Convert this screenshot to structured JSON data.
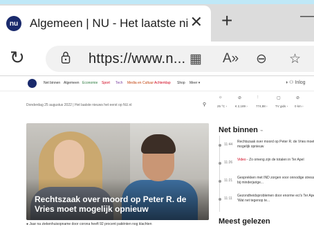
{
  "browser": {
    "tab_title": "Algemeen | NU - Het laatste nieu",
    "favicon_text": "nu",
    "close_symbol": "✕",
    "newtab_symbol": "+",
    "min_symbol": "—",
    "reload_symbol": "↻",
    "url": "https://www.n...",
    "icons": [
      "apps-icon",
      "read-aloud-icon",
      "zoom-out-icon",
      "favorites-add-icon"
    ],
    "icon_glyphs": [
      "▦",
      "A»",
      "⊖",
      "☆"
    ]
  },
  "site": {
    "nav_items": [
      "Net binnen",
      "Algemeen",
      "Economie",
      "Sport",
      "Tech",
      "Media en Cultuur",
      "Achterklap",
      "Shop",
      "Meer ▾"
    ],
    "nav_colors": [
      "#333333",
      "#333333",
      "#2b7a3d",
      "#d0021b",
      "#7a3ea0",
      "#c2410c",
      "#d0021b",
      "#333333",
      "#333333"
    ],
    "nav_right": "◑  ⚇  Inlog",
    "dateline": "Donderdag 25 augustus 2022   |   Het laatste nieuws het eerst op NU.nl",
    "search_symbol": "⚲"
  },
  "hero": {
    "headline": "Rechtszaak over moord op Peter R. de Vries moet mogelijk opnieuw"
  },
  "bullet_text": "●  Jaar na ziekenhuisopname door corona heeft 92 procent patiënten nog klachten",
  "weather": {
    "icons": [
      "☼",
      "⊘",
      "⫶",
      "▢",
      "⊘"
    ],
    "values": [
      "25 °C ›",
      "€ 2,189 ›",
      "774,88 ›",
      "TV gids ›",
      "0 km ›"
    ]
  },
  "net_binnen": {
    "title": "Net binnen",
    "rss": "⌁",
    "items": [
      {
        "time": "11:44",
        "prefix": "",
        "text": "Rechtszaak over moord op Peter R. de Vries moet mogelijk opnieuw"
      },
      {
        "time": "11:26",
        "prefix": "Video",
        "text": " - Zo omeng zijn de totalen in Ter Apel"
      },
      {
        "time": "11:21",
        "prefix": "",
        "text": "Gesprekken met IND zorgen voor onnodige stress bij minderjarige..."
      },
      {
        "time": "11:11",
        "prefix": "",
        "text": "Gezondheidsproblemen door enorme eci's Ter Apel: 'Wat net tegenop te..."
      }
    ]
  },
  "meest_gelezen": {
    "title": "Meest gelezen"
  }
}
